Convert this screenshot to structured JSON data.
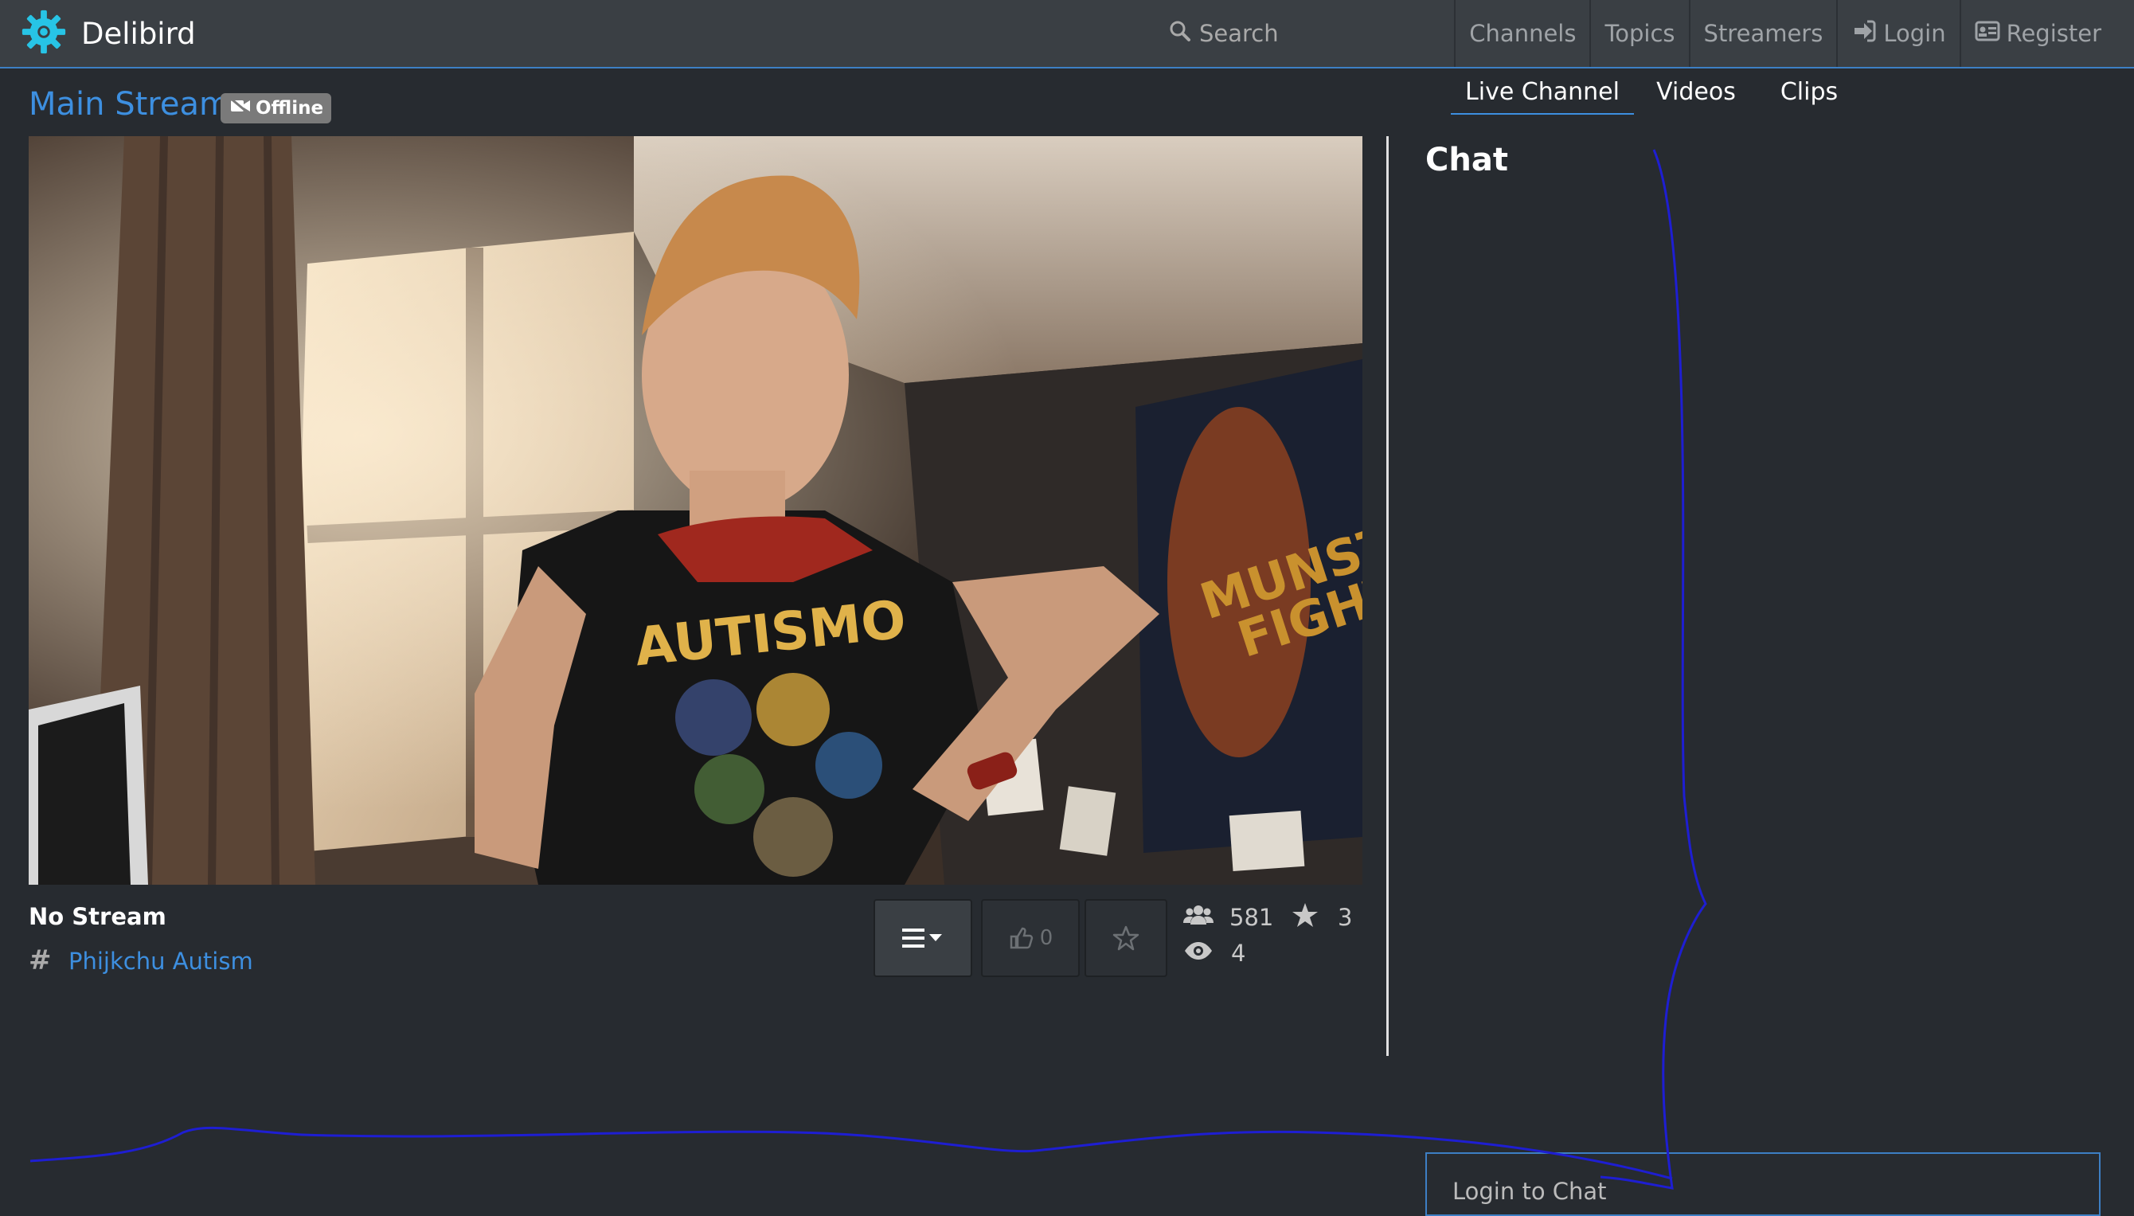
{
  "navbar": {
    "brand": "Delibird",
    "search_label": "Search",
    "links": [
      {
        "label": "Channels",
        "icon": ""
      },
      {
        "label": "Topics",
        "icon": ""
      },
      {
        "label": "Streamers",
        "icon": ""
      },
      {
        "label": "Login",
        "icon": "sign-in-icon"
      },
      {
        "label": "Register",
        "icon": "id-card-icon"
      }
    ]
  },
  "stream": {
    "title": "Main Stream",
    "status_badge": "Offline",
    "status_text": "No Stream",
    "topic": "Phijkchu Autism",
    "likes": "0",
    "followers": "581",
    "favorites": "3",
    "viewers": "4"
  },
  "tabs": [
    {
      "label": "Live Channel",
      "active": true
    },
    {
      "label": "Videos",
      "active": false
    },
    {
      "label": "Clips",
      "active": false
    }
  ],
  "video_image_text": [
    "AUTISMO",
    "MUNSTER FIGHTER"
  ],
  "chat": {
    "title": "Chat",
    "login_placeholder": "Login to Chat"
  },
  "colors": {
    "background": "#272b30",
    "navbar": "#3a3f44",
    "accent": "#3d8fe0",
    "annotation": "#1e1ed2"
  }
}
